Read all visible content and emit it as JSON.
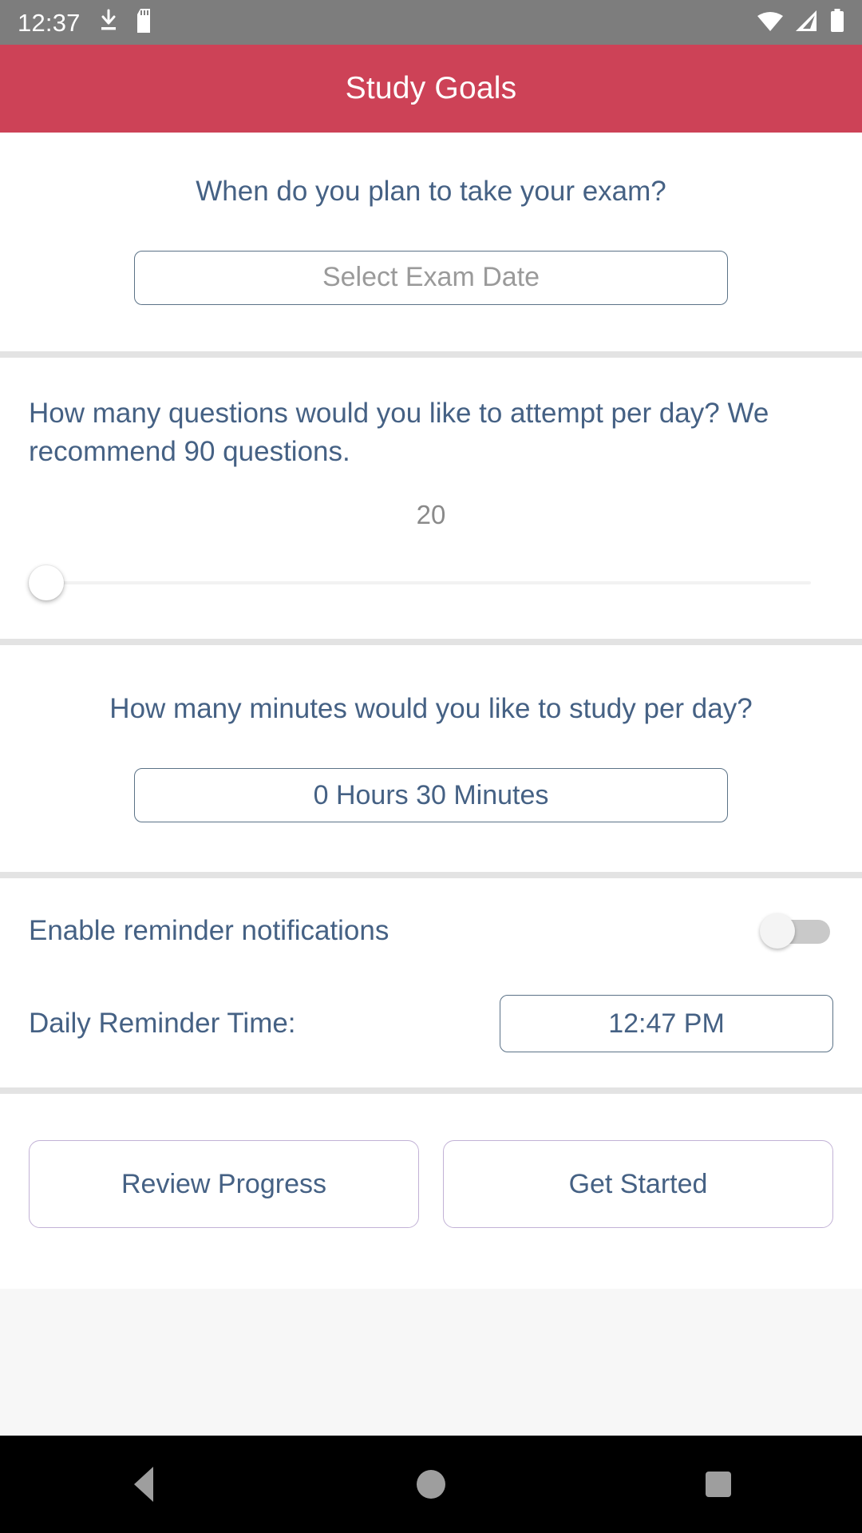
{
  "status_bar": {
    "time": "12:37",
    "left_icons": [
      "download-icon",
      "sd-card-icon"
    ],
    "right_icons": [
      "wifi-icon",
      "cellular-signal-icon",
      "battery-icon"
    ],
    "background_color": "#7d7d7d"
  },
  "app_bar": {
    "title": "Study Goals",
    "background_color": "#cd4257",
    "text_color": "#ffffff"
  },
  "theme": {
    "primary_text": "#456184",
    "placeholder_text": "#9a9a9a",
    "outline": "#5b7287",
    "button_outline": "#c2b2d6",
    "divider": "#e3e3e3"
  },
  "exam_section": {
    "question": "When do you plan to take your exam?",
    "date_field_placeholder": "Select Exam Date",
    "date_field_value": ""
  },
  "questions_section": {
    "question": "How many questions would you like to attempt per day? We recommend 90 questions.",
    "recommended": 90,
    "slider_value": "20",
    "slider_position_percent": 0
  },
  "minutes_section": {
    "question": "How many minutes would you like to study per day?",
    "duration_value": "0 Hours 30 Minutes",
    "hours": 0,
    "minutes": 30
  },
  "reminders_section": {
    "toggle_label": "Enable reminder notifications",
    "toggle_enabled": false,
    "reminder_time_label": "Daily Reminder Time:",
    "reminder_time_value": "12:47 PM"
  },
  "actions": {
    "review_label": "Review Progress",
    "get_started_label": "Get Started"
  },
  "nav_bar": {
    "buttons": [
      "back-button",
      "home-button",
      "recents-button"
    ],
    "background_color": "#000000"
  }
}
